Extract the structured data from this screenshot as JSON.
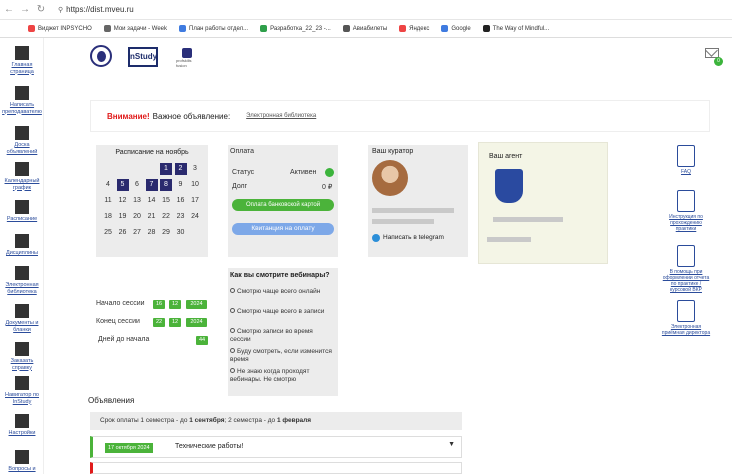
{
  "browser": {
    "url": "https://dist.mveu.ru",
    "bookmarks": [
      {
        "label": "Виджет INPSYCHO",
        "color": "#e44"
      },
      {
        "label": "Мои задачи - Week",
        "color": "#666"
      },
      {
        "label": "План работы отдел...",
        "color": "#3f7be0"
      },
      {
        "label": "Разработка_22_23 -...",
        "color": "#2e9f4a"
      },
      {
        "label": "Авиабилеты",
        "color": "#555"
      },
      {
        "label": "Яндекс",
        "color": "#e44"
      },
      {
        "label": "Google",
        "color": "#3f7be0"
      },
      {
        "label": "The Way of Mindful...",
        "color": "#222"
      }
    ]
  },
  "sidebar": [
    {
      "label": "Главная страница",
      "icon": "home-grid-icon"
    },
    {
      "label": "Написать преподавателю",
      "icon": "mail-icon"
    },
    {
      "label": "Доска объявлений",
      "icon": "board-icon"
    },
    {
      "label": "Календарный график",
      "icon": "chart-icon"
    },
    {
      "label": "Расписание",
      "icon": "calendar-icon"
    },
    {
      "label": "Дисциплины",
      "icon": "graduation-cap-icon"
    },
    {
      "label": "Электронная библиотека",
      "icon": "bookmark-icon"
    },
    {
      "label": "Документы и бланки",
      "icon": "paperclip-icon"
    },
    {
      "label": "Заказать справку",
      "icon": "folder-icon"
    },
    {
      "label": "Навигатор по InStudy",
      "icon": "puzzle-icon"
    },
    {
      "label": "Настройки",
      "icon": "gear-icon"
    },
    {
      "label": "Вопросы и",
      "icon": "chat-icon"
    }
  ],
  "header": {
    "logo_center": "nStudy",
    "logo_right_a": "profskills",
    "logo_right_b": "fusion",
    "mail_count": "0"
  },
  "announcement": {
    "attention": "Внимание!",
    "text": "Важное объявление:",
    "link": "Электронная библиотека"
  },
  "schedule": {
    "title": "Расписание на ноябрь",
    "rows": [
      [
        "",
        "",
        "",
        "",
        "1",
        "2",
        "3"
      ],
      [
        "4",
        "5",
        "6",
        "7",
        "8",
        "9",
        "10"
      ],
      [
        "11",
        "12",
        "13",
        "14",
        "15",
        "16",
        "17"
      ],
      [
        "18",
        "19",
        "20",
        "21",
        "22",
        "23",
        "24"
      ],
      [
        "25",
        "26",
        "27",
        "28",
        "29",
        "30",
        ""
      ]
    ],
    "highlighted": [
      "1",
      "2",
      "5",
      "7",
      "8"
    ]
  },
  "payment": {
    "title": "Оплата",
    "status_label": "Статус",
    "status_value": "Активен",
    "status_color": "#3cb43c",
    "debt_label": "Долг",
    "debt_value": "0 ₽",
    "card_button": "Оплата банковской картой",
    "receipt_button": "Квитанция на оплату"
  },
  "curator": {
    "title": "Ваш куратор",
    "telegram": "Написать в telegram"
  },
  "agent": {
    "title": "Ваш агент"
  },
  "right_links": [
    {
      "label": "FAQ",
      "icon": "faq-icon"
    },
    {
      "label": "Инструкция по прохождению практики",
      "icon": "book-icon"
    },
    {
      "label": "В помощь при оформлении отчета по практике / курсовой ВКР",
      "icon": "lifebuoy-icon"
    },
    {
      "label": "Электронная приёмная директора",
      "icon": "speech-icon"
    }
  ],
  "session": {
    "start_label": "Начало сессии",
    "start": [
      "16",
      "12",
      "2024"
    ],
    "end_label": "Конец сессии",
    "end": [
      "22",
      "12",
      "2024"
    ],
    "days_label": "Дней до начала",
    "days": "44"
  },
  "poll": {
    "title": "Как вы смотрите вебинары?",
    "options": [
      "Смотрю чаще всего онлайн",
      "Смотрю чаще всего в записи",
      "Смотрю записи во время сессии",
      "Буду смотреть, если изменится время",
      "Не знаю когда проходят вебинары. Не смотрю"
    ]
  },
  "announcements": {
    "title": "Объявления",
    "bar_a": "Срок оплаты 1 семестра - до ",
    "bar_b": "1 сентября",
    "bar_c": "; 2 семестра - до ",
    "bar_d": "1 февраля",
    "item_date": "17 октября 2024",
    "item_text": "Технические работы!"
  }
}
